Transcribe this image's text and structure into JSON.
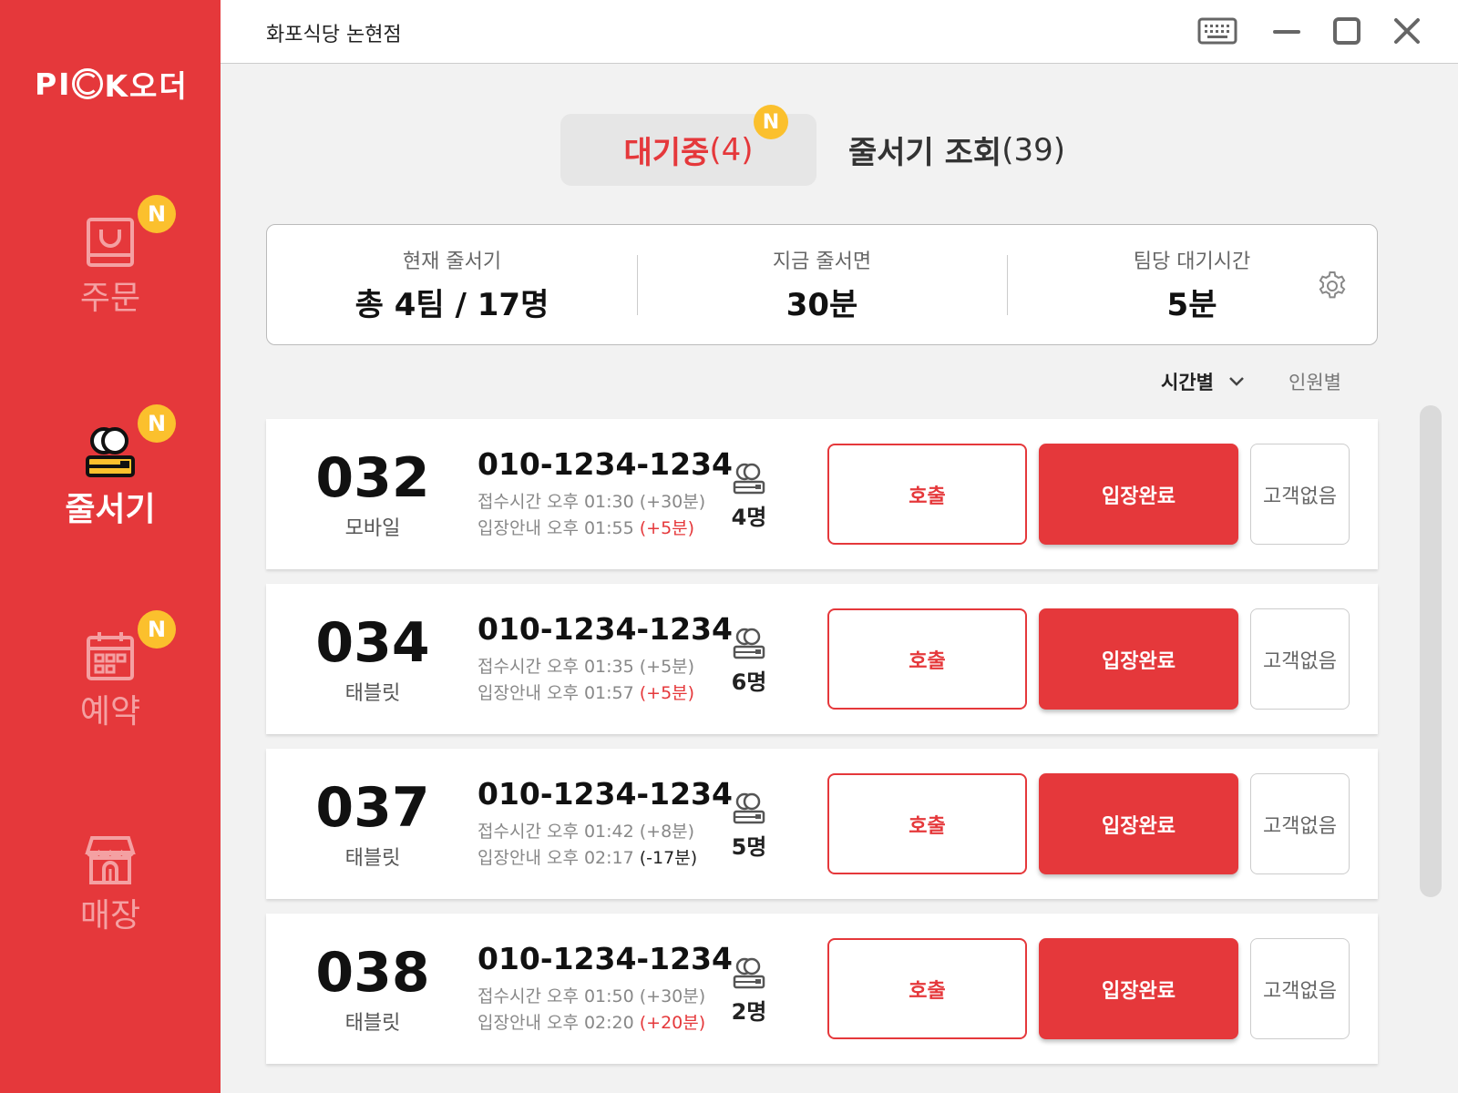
{
  "app": {
    "logo_left": "PI",
    "logo_right": "K오더",
    "store_name": "화포식당 논현점"
  },
  "sidebar": {
    "items": [
      {
        "label": "주문",
        "icon": "shopping-bag-icon",
        "badge": "N",
        "active": false
      },
      {
        "label": "줄서기",
        "icon": "queue-icon",
        "badge": "N",
        "active": true
      },
      {
        "label": "예약",
        "icon": "calendar-icon",
        "badge": "N",
        "active": false
      },
      {
        "label": "매장",
        "icon": "store-icon",
        "badge": "",
        "active": false
      }
    ]
  },
  "tabs": {
    "waiting_label": "대기중",
    "waiting_count": "(4)",
    "waiting_badge": "N",
    "history_label": "줄서기 조회",
    "history_count": "(39)"
  },
  "summary": {
    "current_label": "현재 줄서기",
    "current_value": "총 4팀 / 17명",
    "now_label": "지금 줄서면",
    "now_value": "30분",
    "per_team_label": "팀당 대기시간",
    "per_team_value": "5분"
  },
  "sort": {
    "by_time": "시간별",
    "by_people": "인원별"
  },
  "buttons": {
    "call": "호출",
    "enter": "입장완료",
    "noshow": "고객없음"
  },
  "queue": [
    {
      "number": "032",
      "channel": "모바일",
      "phone": "010-1234-1234",
      "received": "접수시간 오후 01:30 (+30분)",
      "guide": "입장안내 오후 01:55",
      "guide_diff": "(+5분)",
      "diff_color": "red",
      "people": "4명"
    },
    {
      "number": "034",
      "channel": "태블릿",
      "phone": "010-1234-1234",
      "received": "접수시간 오후 01:35 (+5분)",
      "guide": "입장안내 오후 01:57",
      "guide_diff": "(+5분)",
      "diff_color": "red",
      "people": "6명"
    },
    {
      "number": "037",
      "channel": "태블릿",
      "phone": "010-1234-1234",
      "received": "접수시간 오후 01:42 (+8분)",
      "guide": "입장안내 오후 02:17",
      "guide_diff": "(-17분)",
      "diff_color": "dark",
      "people": "5명"
    },
    {
      "number": "038",
      "channel": "태블릿",
      "phone": "010-1234-1234",
      "received": "접수시간 오후 01:50 (+30분)",
      "guide": "입장안내 오후 02:20",
      "guide_diff": "(+20분)",
      "diff_color": "red",
      "people": "2명"
    }
  ],
  "colors": {
    "brand_red": "#e5383b",
    "badge_yellow": "#fbc02d"
  }
}
